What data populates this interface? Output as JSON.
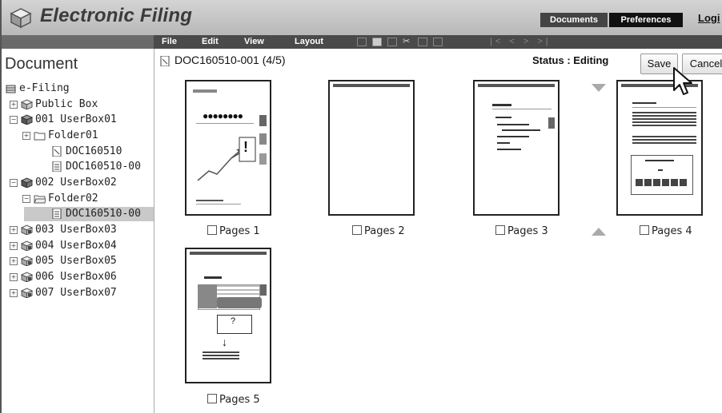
{
  "app": {
    "title": "Electronic Filing"
  },
  "topnav": {
    "documents": "Documents",
    "preferences": "Preferences",
    "login": "Logi"
  },
  "menubar": {
    "file": "File",
    "edit": "Edit",
    "view": "View",
    "layout": "Layout",
    "nav": "|< < > >|"
  },
  "sidebar": {
    "title": "Document",
    "root": "e-Filing",
    "items": [
      {
        "label": "Public Box"
      },
      {
        "label": "001 UserBox01"
      },
      {
        "label": "Folder01"
      },
      {
        "label": "DOC160510"
      },
      {
        "label": "DOC160510-00"
      },
      {
        "label": "002 UserBox02"
      },
      {
        "label": "Folder02"
      },
      {
        "label": "DOC160510-00"
      },
      {
        "label": "003 UserBox03"
      },
      {
        "label": "004 UserBox04"
      },
      {
        "label": "005 UserBox05"
      },
      {
        "label": "006 UserBox06"
      },
      {
        "label": "007 UserBox07"
      }
    ]
  },
  "document": {
    "name": "DOC160510-001 (4/5)",
    "status": "Status : Editing"
  },
  "buttons": {
    "save": "Save",
    "cancel": "Cancel"
  },
  "pages": [
    {
      "label": "Pages 1"
    },
    {
      "label": "Pages 2"
    },
    {
      "label": "Pages 3"
    },
    {
      "label": "Pages 4"
    },
    {
      "label": "Pages 5"
    }
  ],
  "thumb_text": {
    "page1_callout": "!",
    "page5_callout": "?"
  },
  "colors": {
    "titlebar": "#c6c6c6",
    "menubar": "#4a4a4a",
    "selected_row": "#c9c9c9"
  }
}
